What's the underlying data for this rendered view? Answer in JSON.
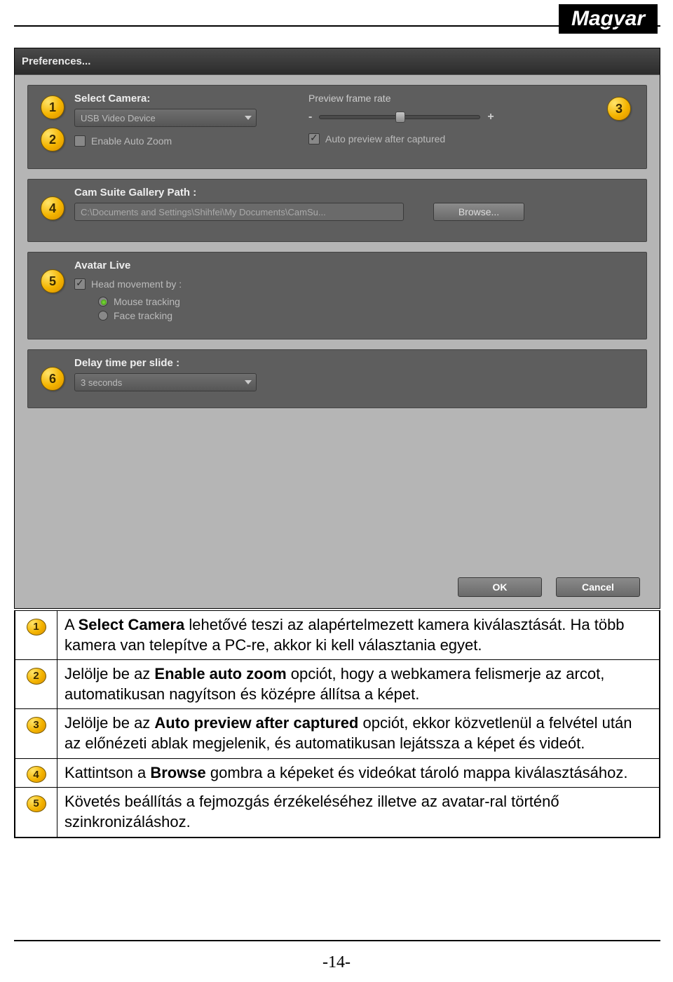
{
  "language_tab": "Magyar",
  "window": {
    "title": "Preferences..."
  },
  "camera": {
    "label": "Select Camera:",
    "selected": "USB Video Device",
    "enable_auto_zoom": "Enable Auto Zoom",
    "preview_frame_rate": "Preview frame rate",
    "slider_min": "-",
    "slider_max": "+",
    "auto_preview": "Auto preview after captured"
  },
  "gallery": {
    "label": "Cam Suite Gallery Path :",
    "path": "C:\\Documents and Settings\\Shihfei\\My Documents\\CamSu...",
    "browse": "Browse..."
  },
  "avatar": {
    "label": "Avatar Live",
    "head_movement": "Head movement by :",
    "mouse": "Mouse tracking",
    "face": "Face tracking"
  },
  "delay": {
    "label": "Delay time per slide :",
    "value": "3 seconds"
  },
  "buttons": {
    "ok": "OK",
    "cancel": "Cancel"
  },
  "badges": {
    "b1": "1",
    "b2": "2",
    "b3": "3",
    "b4": "4",
    "b5": "5",
    "b6": "6"
  },
  "legend": {
    "r1": {
      "num": "1",
      "pre": "A ",
      "kw": "Select Camera",
      "post": " lehetővé teszi az alapértelmezett kamera kiválasztását. Ha több kamera van telepítve a PC-re, akkor ki kell választania egyet."
    },
    "r2": {
      "num": "2",
      "pre": "Jelölje be az ",
      "kw": "Enable auto zoom",
      "post": " opciót, hogy a webkamera felismerje az arcot, automatikusan nagyítson és középre állítsa a képet."
    },
    "r3": {
      "num": "3",
      "pre": "Jelölje be az ",
      "kw": "Auto preview after captured",
      "post": " opciót, ekkor közvetlenül a felvétel után az előnézeti ablak megjelenik, és automatikusan lejátssza a képet és videót."
    },
    "r4": {
      "num": "4",
      "pre": "Kattintson a ",
      "kw": "Browse",
      "post": " gombra a képeket és videókat tároló mappa kiválasztásához."
    },
    "r5": {
      "num": "5",
      "pre": "",
      "kw": "",
      "post": "Követés beállítás a fejmozgás érzékeléséhez illetve az avatar-ral történő szinkronizáláshoz."
    }
  },
  "page_number": "-14-"
}
